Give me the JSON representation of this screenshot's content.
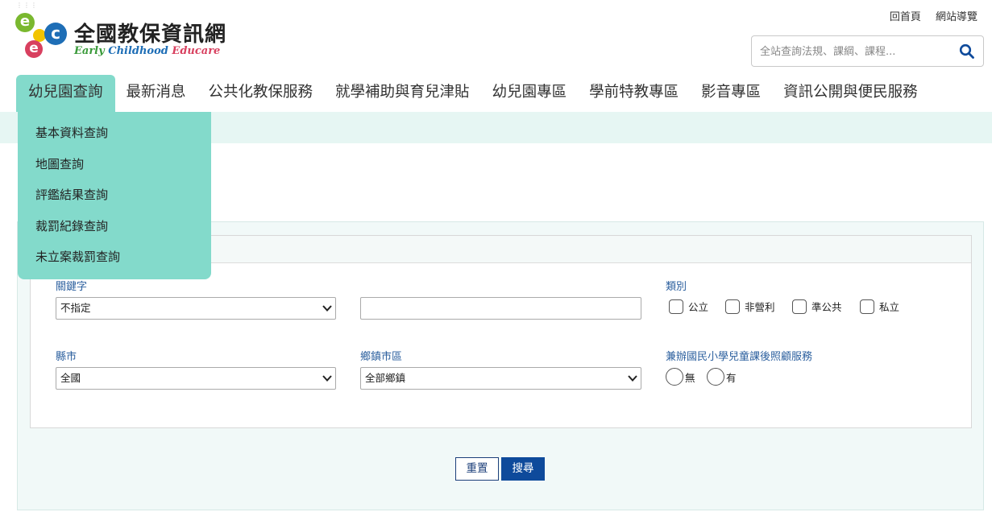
{
  "site": {
    "title": "全國教保資訊網",
    "subtitle_words": [
      "Early",
      "Childhood",
      "Educare"
    ],
    "logo_letters": [
      "e",
      "e",
      "c"
    ]
  },
  "top_links": [
    "回首頁",
    "網站導覽"
  ],
  "search": {
    "placeholder": "全站查詢法規、課綱、課程..."
  },
  "nav": {
    "items": [
      "幼兒園查詢",
      "最新消息",
      "公共化教保服務",
      "就學補助與育兒津貼",
      "幼兒園專區",
      "學前特教專區",
      "影音專區",
      "資訊公開與便民服務"
    ],
    "active_index": 0
  },
  "dropdown": {
    "items": [
      "基本資料查詢",
      "地圖查詢",
      "評鑑結果查詢",
      "裁罰紀錄查詢",
      "未立案裁罰查詢"
    ]
  },
  "form": {
    "keyword_label": "關鍵字",
    "keyword_select_value": "不指定",
    "keyword_text_value": "",
    "category_label": "類別",
    "categories": [
      "公立",
      "非營利",
      "準公共",
      "私立"
    ],
    "city_label": "縣市",
    "city_value": "全國",
    "district_label": "鄉鎮市區",
    "district_value": "全部鄉鎮",
    "after_school_label": "兼辦國民小學兒童課後照顧服務",
    "after_school_options": [
      "無",
      "有"
    ],
    "reset_label": "重置",
    "search_label": "搜尋"
  },
  "colors": {
    "accent": "#83dacb",
    "band": "#e6f6f3",
    "label_blue": "#2b5f9e",
    "button_blue": "#0e4a9b"
  }
}
